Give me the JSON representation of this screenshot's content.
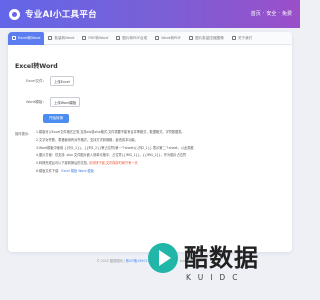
{
  "header": {
    "title": "专业AI小工具平台",
    "nav": [
      "首页",
      "安全",
      "免费"
    ],
    "nav_sep": "·"
  },
  "tabs": [
    {
      "label": "Excel转Word",
      "icon": "file-icon",
      "active": true
    },
    {
      "label": "批量转Word",
      "icon": "file-icon",
      "active": false
    },
    {
      "label": "PDF转Word",
      "icon": "file-icon",
      "active": false
    },
    {
      "label": "图片转PDF合成",
      "icon": "image-icon",
      "active": false
    },
    {
      "label": "Word转PDF",
      "icon": "file-icon",
      "active": false
    },
    {
      "label": "图片批量压缩图像",
      "icon": "image-icon",
      "active": false
    },
    {
      "label": "关于我们",
      "icon": "info-icon",
      "active": false
    }
  ],
  "tool": {
    "title": "Excel转Word",
    "excel_label": "Excel文件：",
    "excel_button": "上传Excel",
    "word_label": "Word模板：",
    "word_button": "上传Word模板",
    "convert_button": "开始转换"
  },
  "tips": {
    "title": "操作提示：",
    "items": [
      {
        "text": "1.模板可以Excel文件格式正常,支持xls或xlsx格式,文件需要不能有合并等格式，数据格式，字符数据类。",
        "accent": "",
        "link": ""
      },
      {
        "text": "2.文字对齐数，表格使用有对齐格式，支持方式转换格，最低成本功能。",
        "accent": "",
        "link": ""
      },
      {
        "text": "3.Word模板中使用 {{列1_1}}，{{列1_2}}等占位符(第一个sheet){{列2_1}} 表示第二个sheet，以此类推",
        "accent": "",
        "link": ""
      },
      {
        "text": "4.图片方面：仅支持 .xlsx 文件图片嵌入到单元格中，占位符{{IMG_1}}，{{IMG_2}}，作为图片占位符",
        "accent": "",
        "link": ""
      },
      {
        "text": "5.转换完成后可以下载转换后的文档, ",
        "accent": "请尽快下载,文件保存时间只有一天",
        "link": ""
      },
      {
        "text": "6.模板文件下载：",
        "accent": "",
        "link": "Excel 模板  Word 模板"
      }
    ]
  },
  "footer": {
    "copyright": "© 2025 酷数据网 |",
    "icp": "豫ICP备19001711号-2",
    "mid": "| 联系邮箱：",
    "email": "kuidc@qq.com"
  },
  "watermark": {
    "text": "酷数据",
    "sub": "KUIDC"
  }
}
